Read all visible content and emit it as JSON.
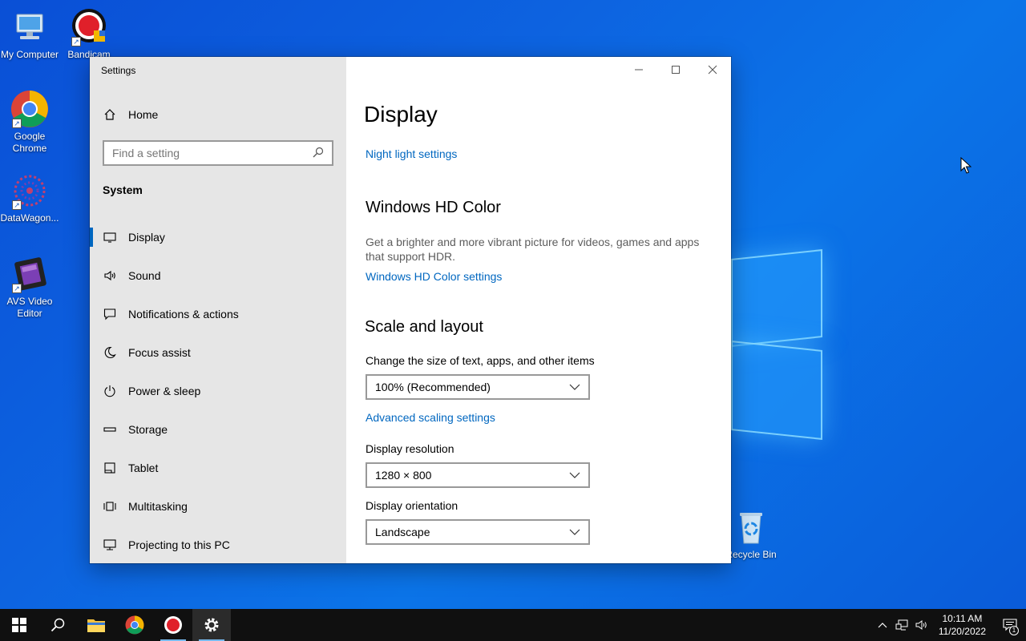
{
  "desktop": {
    "icons": [
      {
        "label": "My Computer",
        "icon": "computer-icon"
      },
      {
        "label": "Bandicam",
        "icon": "bandicam-icon"
      },
      {
        "label": "Google Chrome",
        "icon": "chrome-icon"
      },
      {
        "label": "DataWagon...",
        "icon": "datawagon-icon"
      },
      {
        "label": "AVS Video Editor",
        "icon": "avs-video-editor-icon"
      },
      {
        "label": "Recycle Bin",
        "icon": "recycle-bin-icon"
      }
    ]
  },
  "window": {
    "title": "Settings",
    "sidebar": {
      "home_label": "Home",
      "search_placeholder": "Find a setting",
      "section": "System",
      "items": [
        {
          "label": "Display",
          "icon": "monitor-icon",
          "active": true
        },
        {
          "label": "Sound",
          "icon": "speaker-icon"
        },
        {
          "label": "Notifications & actions",
          "icon": "notification-icon"
        },
        {
          "label": "Focus assist",
          "icon": "moon-icon"
        },
        {
          "label": "Power & sleep",
          "icon": "power-icon"
        },
        {
          "label": "Storage",
          "icon": "storage-icon"
        },
        {
          "label": "Tablet",
          "icon": "tablet-icon"
        },
        {
          "label": "Multitasking",
          "icon": "multitasking-icon"
        },
        {
          "label": "Projecting to this PC",
          "icon": "projecting-icon"
        }
      ]
    },
    "content": {
      "title": "Display",
      "night_light_link": "Night light settings",
      "hd_color": {
        "heading": "Windows HD Color",
        "description": "Get a brighter and more vibrant picture for videos, games and apps that support HDR.",
        "link": "Windows HD Color settings"
      },
      "scale_layout": {
        "heading": "Scale and layout",
        "scale_label": "Change the size of text, apps, and other items",
        "scale_value": "100% (Recommended)",
        "advanced_link": "Advanced scaling settings",
        "resolution_label": "Display resolution",
        "resolution_value": "1280 × 800",
        "orientation_label": "Display orientation",
        "orientation_value": "Landscape"
      }
    }
  },
  "taskbar": {
    "time": "10:11 AM",
    "date": "11/20/2022",
    "notification_count": "1"
  },
  "colors": {
    "accent": "#0067c0",
    "sidebar_bg": "#e6e6e6",
    "taskbar_bg": "#101010"
  }
}
